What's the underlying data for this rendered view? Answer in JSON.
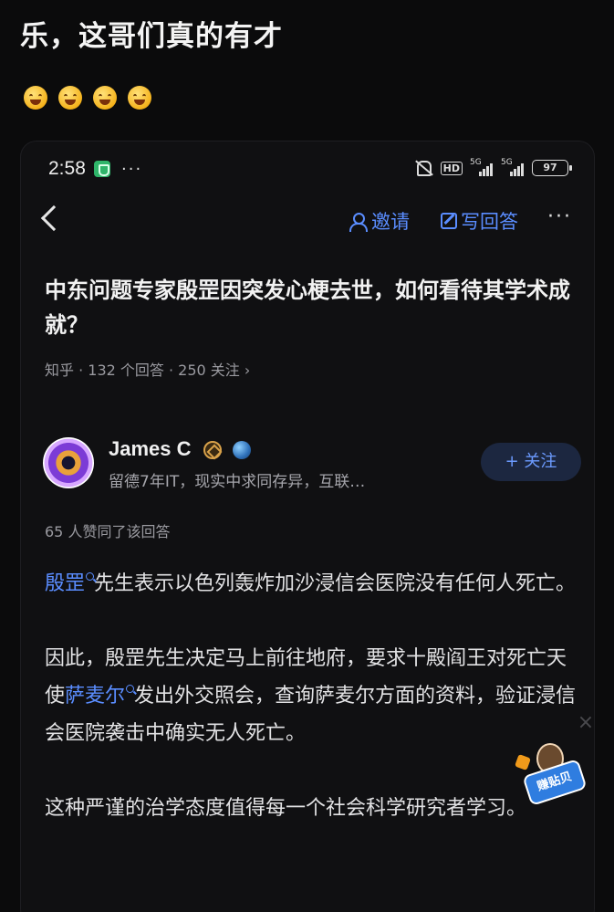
{
  "post": {
    "title": "乐，这哥们真的有才",
    "emoji_count_note": "",
    "emojis": [
      "grin-squint-emoji",
      "grin-squint-emoji",
      "grin-squint-emoji",
      "grin-squint-emoji"
    ]
  },
  "status_bar": {
    "time": "2:58",
    "dots": "···",
    "hd": "HD",
    "signal1": "5G",
    "signal2": "5G",
    "battery": "97"
  },
  "nav": {
    "invite_label": "邀请",
    "write_label": "写回答",
    "more": "···"
  },
  "question": {
    "title": "中东问题专家殷罡因突发心梗去世，如何看待其学术成就？",
    "meta": "知乎 · 132 个回答 · 250 关注 ›"
  },
  "author": {
    "name": "James C",
    "bio": "留德7年IT，现实中求同存异，互联…",
    "follow_label": "+ 关注"
  },
  "answer": {
    "upvotes": "65 人赞同了该回答",
    "p1_link": "殷罡",
    "p1_rest": "先生表示以色列轰炸加沙浸信会医院没有任何人死亡。",
    "p2_a": "因此，殷罡先生决定马上前往地府，要求十殿阎王对死亡天使",
    "p2_link": "萨麦尔",
    "p2_b": "发出外交照会，查询萨麦尔方面的资料，验证浸信会医院袭击中确实无人死亡。",
    "p3": "这种严谨的治学态度值得每一个社会科学研究者学习。"
  },
  "sticker": {
    "label": "赚贴贝"
  },
  "colors": {
    "link": "#5a8dff",
    "background": "#0b0b0c"
  }
}
